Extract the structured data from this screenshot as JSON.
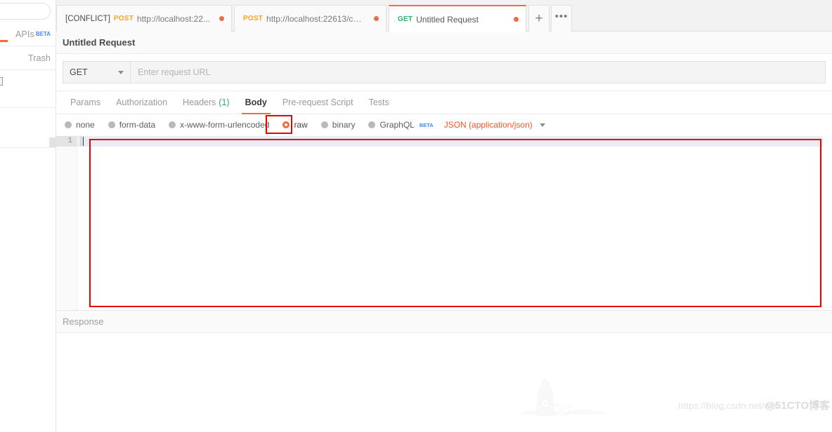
{
  "sidebar": {
    "search_placeholder": "",
    "items": [
      {
        "label": "APIs",
        "badge": "BETA"
      },
      {
        "label": "Trash",
        "badge": ""
      }
    ]
  },
  "tabstrip": {
    "tabs": [
      {
        "prefix": "[CONFLICT]",
        "method": "POST",
        "title": "http://localhost:22...",
        "unsaved": true,
        "active": false
      },
      {
        "prefix": "",
        "method": "POST",
        "title": "http://localhost:22613/cpic/ve...",
        "unsaved": true,
        "active": false
      },
      {
        "prefix": "",
        "method": "GET",
        "title": "Untitled Request",
        "unsaved": true,
        "active": true
      }
    ],
    "new_tab_icon": "plus-icon",
    "more_icon": "ellipsis-icon"
  },
  "request": {
    "title": "Untitled Request",
    "method": "GET",
    "url_value": "",
    "url_placeholder": "Enter request URL",
    "tabs": [
      {
        "label": "Params",
        "count": "",
        "active": false
      },
      {
        "label": "Authorization",
        "count": "",
        "active": false
      },
      {
        "label": "Headers",
        "count": "(1)",
        "active": false
      },
      {
        "label": "Body",
        "count": "",
        "active": true
      },
      {
        "label": "Pre-request Script",
        "count": "",
        "active": false
      },
      {
        "label": "Tests",
        "count": "",
        "active": false
      }
    ]
  },
  "body": {
    "types": [
      {
        "label": "none",
        "selected": false,
        "badge": ""
      },
      {
        "label": "form-data",
        "selected": false,
        "badge": ""
      },
      {
        "label": "x-www-form-urlencoded",
        "selected": false,
        "badge": ""
      },
      {
        "label": "raw",
        "selected": true,
        "badge": ""
      },
      {
        "label": "binary",
        "selected": false,
        "badge": ""
      },
      {
        "label": "GraphQL",
        "selected": false,
        "badge": "BETA"
      }
    ],
    "format_selected": "JSON (application/json)",
    "format_caret_icon": "chevron-down-icon",
    "editor_line_number": "1",
    "editor_content": ""
  },
  "response": {
    "title": "Response",
    "illustration": "rocket-illustration"
  },
  "watermark": {
    "url": "https://blog.csdn.net/wei",
    "brand": "@51CTO博客"
  },
  "colors": {
    "accent": "#f26b3a",
    "method_post": "#f5a623",
    "method_get": "#2eae6a",
    "highlight_box": "#ef0000",
    "beta_badge": "#3d8ef7",
    "format_text": "#f05a28"
  }
}
